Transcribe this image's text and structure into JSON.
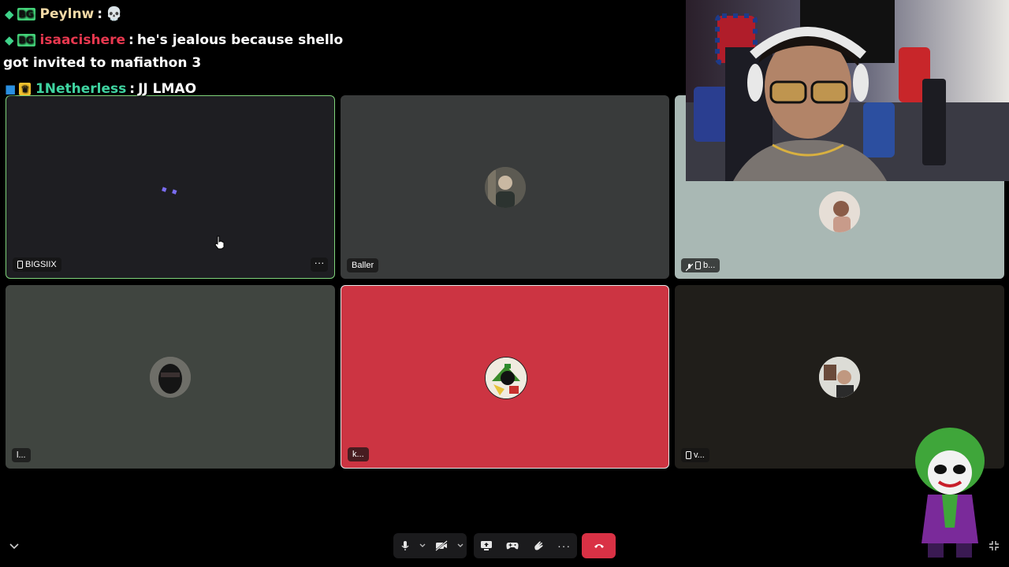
{
  "chat": {
    "messages": [
      {
        "username": "Peylnw",
        "text": "💀",
        "username_color": "#f1d9a6",
        "badges": [
          "gem",
          "BG"
        ]
      },
      {
        "username": "isaacishere",
        "text": "he's jealous because shello got invited to mafiathon 3",
        "username_color": "#e8384f",
        "badges": [
          "gem",
          "BG"
        ]
      },
      {
        "username": "1Netherless",
        "text": "JJ LMAO",
        "username_color": "#3fd3a0",
        "badges": [
          "cube",
          "crown"
        ]
      }
    ],
    "separator": ":"
  },
  "tiles": [
    {
      "id": "bigsiix",
      "name": "BIGSIIX",
      "device": "phone",
      "bg": "#1e1e22",
      "active": true,
      "has_more": true,
      "more_label": "···",
      "avatar": "loading"
    },
    {
      "id": "baller",
      "name": "Baller",
      "device": "none",
      "bg": "#393b3b",
      "active": false,
      "has_more": false,
      "avatar": "photo-man"
    },
    {
      "id": "b",
      "name": "b...",
      "device": "phone-muted",
      "bg": "#a9b8b4",
      "active": false,
      "has_more": false,
      "avatar": "photo-woman"
    },
    {
      "id": "l",
      "name": "l...",
      "device": "none",
      "bg": "#404540",
      "active": false,
      "has_more": false,
      "avatar": "photo-mask"
    },
    {
      "id": "k",
      "name": "k...",
      "device": "none",
      "bg": "#cc3442",
      "active": false,
      "has_more": false,
      "avatar": "cartoon-martian"
    },
    {
      "id": "v",
      "name": "v...",
      "device": "phone",
      "bg": "#201e1a",
      "active": false,
      "has_more": false,
      "avatar": "photo-selfie"
    }
  ],
  "toolbar": {
    "icons": {
      "mic": "microphone-icon",
      "camera_off": "camera-off-icon",
      "screen_share": "screen-share-icon",
      "activity": "gamepad-icon",
      "soundboard": "soundboard-icon",
      "more": "more-icon",
      "end_call": "hang-up-icon"
    },
    "more_label": "···",
    "colors": {
      "bar": "#1b1b1d",
      "end_call": "#d93145"
    }
  },
  "corner": {
    "left_icon": "chevron-down-icon",
    "right_icon": "collapse-icon"
  },
  "colors": {
    "active_border": "#7fd47a",
    "background": "#000000"
  }
}
